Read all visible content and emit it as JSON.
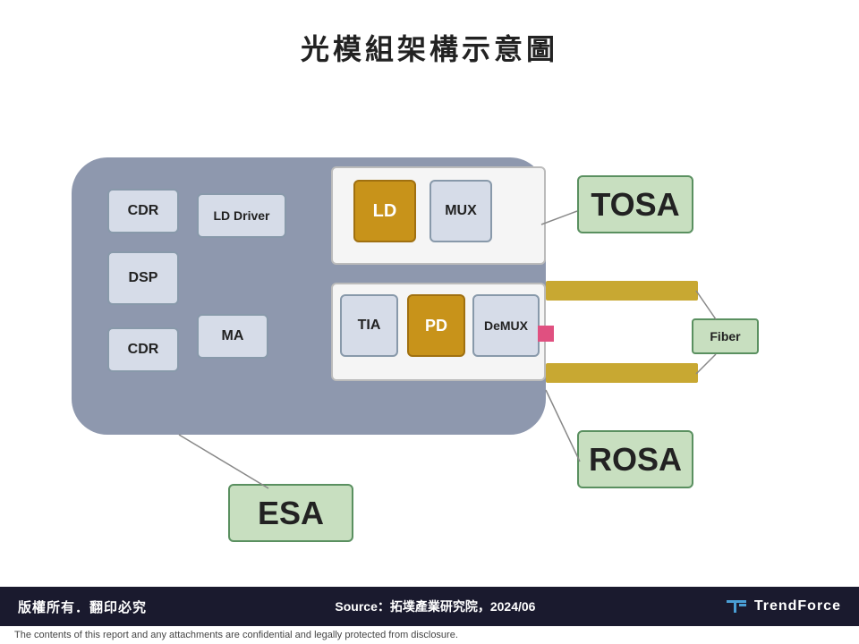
{
  "title": "光模組架構示意圖",
  "diagram": {
    "labels": {
      "tosa": "TOSA",
      "rosa": "ROSA",
      "esa": "ESA",
      "fiber": "Fiber"
    },
    "components": {
      "cdr_top": "CDR",
      "dsp": "DSP",
      "cdr_bot": "CDR",
      "ld_driver": "LD Driver",
      "ma": "MA",
      "ld": "LD",
      "mux": "MUX",
      "tia": "TIA",
      "pd": "PD",
      "demux": "DeMUX"
    }
  },
  "footer": {
    "copyright": "版權所有．翻印必究",
    "source_label": "Source",
    "source_text": "：拓墣產業研究院，2024/06",
    "logo_text": "TrendForce",
    "disclaimer": "The contents of this report and any attachments are confidential and legally protected from disclosure."
  }
}
